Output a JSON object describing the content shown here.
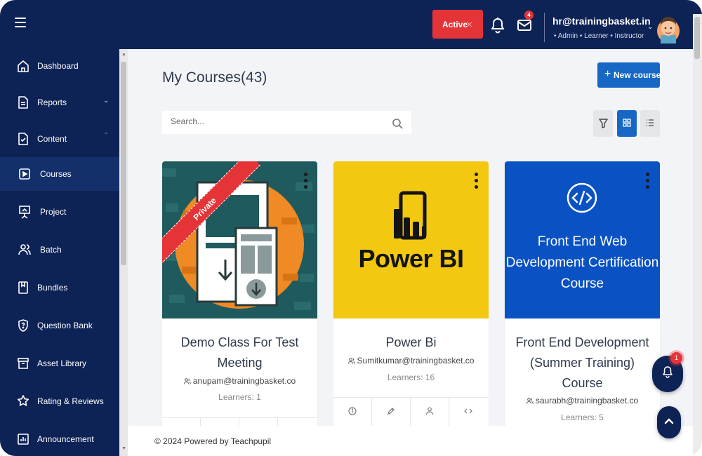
{
  "header": {
    "status_label": "Active",
    "mail_count": "4",
    "user_email": "hr@trainingbasket.in",
    "user_roles": "• Admin • Learner • Instructor"
  },
  "sidebar": {
    "items": [
      {
        "label": "Dashboard",
        "icon": "home-icon"
      },
      {
        "label": "Reports",
        "icon": "report-icon"
      },
      {
        "label": "Content",
        "icon": "content-icon"
      },
      {
        "label": "Courses",
        "icon": "play-square-icon"
      },
      {
        "label": "Project",
        "icon": "presentation-icon"
      },
      {
        "label": "Batch",
        "icon": "users-icon"
      },
      {
        "label": "Bundles",
        "icon": "bookmark-icon"
      },
      {
        "label": "Question Bank",
        "icon": "shield-question-icon"
      },
      {
        "label": "Asset Library",
        "icon": "archive-icon"
      },
      {
        "label": "Rating & Reviews",
        "icon": "star-icon"
      },
      {
        "label": "Announcement",
        "icon": "announcement-icon"
      }
    ]
  },
  "main": {
    "title": "My Courses(43)",
    "new_course_label": "New course",
    "search_placeholder": "Search..."
  },
  "courses": [
    {
      "title": "Demo Class For Test Meeting",
      "author": "anupam@trainingbasket.co",
      "learners": "Learners: 1",
      "badge": "Private"
    },
    {
      "title": "Power Bi",
      "author": "Sumitkumar@trainingbasket.co",
      "learners": "Learners: 16",
      "thumb_text": "Power BI"
    },
    {
      "title": "Front End Development (Summer Training) Course",
      "author": "saurabh@trainingbasket.co",
      "learners": "Learners: 5",
      "thumb_text": "Front End Web Development Certification Course"
    }
  ],
  "notifications": {
    "count": "1"
  },
  "footer": {
    "text": "© 2024 Powered by Teachpupil"
  },
  "colors": {
    "navy": "#0e2355",
    "accent": "#1768c4",
    "danger": "#e53438",
    "powerbi_yellow": "#f2c811"
  }
}
